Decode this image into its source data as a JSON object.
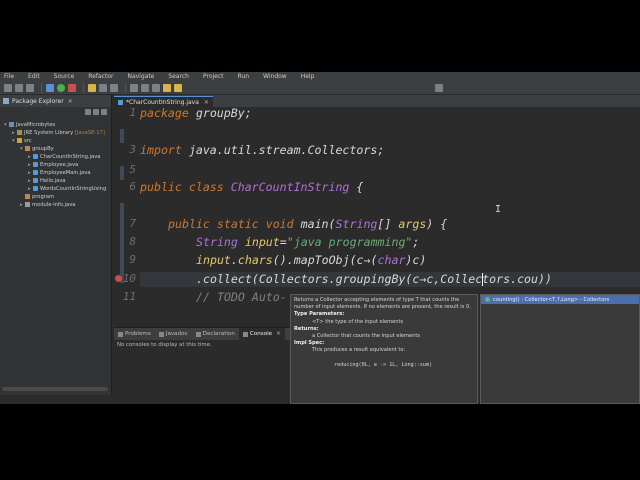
{
  "menu": [
    "File",
    "Edit",
    "Source",
    "Refactor",
    "Navigate",
    "Search",
    "Project",
    "Run",
    "Window",
    "Help"
  ],
  "explorer": {
    "tab_label": "Package Explorer",
    "tree": [
      {
        "label": "JavaMicrobytes",
        "suffix": ""
      },
      {
        "label": "JRE System Library",
        "suffix": "[JavaSE-17]"
      },
      {
        "label": "src",
        "suffix": ""
      },
      {
        "label": "groupBy",
        "suffix": ""
      },
      {
        "label": "CharCountInString.java",
        "suffix": ""
      },
      {
        "label": "Employee.java",
        "suffix": ""
      },
      {
        "label": "EmployeeMain.java",
        "suffix": ""
      },
      {
        "label": "Hello.java",
        "suffix": ""
      },
      {
        "label": "WordsCountInStringUsing",
        "suffix": ""
      },
      {
        "label": "program",
        "suffix": ""
      },
      {
        "label": "module-info.java",
        "suffix": ""
      }
    ]
  },
  "editor": {
    "tab_label": "*CharCountInString.java",
    "line_numbers": [
      "1",
      "3",
      "5",
      "6",
      "7",
      "8",
      "9",
      "10",
      "11"
    ],
    "code": {
      "l1_kw": "package",
      "l1_rest": " groupBy;",
      "l3_kw": "import",
      "l3_rest": " java.util.stream.Collectors;",
      "l5_kw": "public class",
      "l5_name": " CharCountInString",
      "l5_rest": " {",
      "l7_kw": "public static void",
      "l7_rest": " main(",
      "l7_type": "String",
      "l7_arr": "[] ",
      "l7_arg": "args",
      "l7_end": ") {",
      "l8_type": "String",
      "l8_var": " input",
      "l8_eq": "=",
      "l8_str": "\"java programming\"",
      "l8_end": ";",
      "l9_var": "input",
      "l9_dot": ".",
      "l9_var2": "chars",
      "l9_rest": "().mapToObj(c→(",
      "l9_type": "char",
      "l9_end": ")c)",
      "l10": ".collect(Collectors.groupingBy(c→c,Collectors.cou))",
      "l11": "// TODO Auto-"
    }
  },
  "console": {
    "tabs": [
      "Problems",
      "Javadoc",
      "Declaration",
      "Console"
    ],
    "message": "No consoles to display at this time."
  },
  "javadoc": {
    "summary": "Returns a Collector accepting elements of type T that counts the number of input elements. If no elements are present, the result is 0.",
    "type_params_heading": "Type Parameters:",
    "type_param": "<T> the type of the input elements",
    "returns_heading": "Returns:",
    "returns": "a Collector that counts the input elements",
    "impl_heading": "Impl Spec:",
    "impl": "This produces a result equivalent to:",
    "code": "reducing(0L, e -> 1L, Long::sum)"
  },
  "completion": {
    "item": "counting() : Collector<T,?,Long> - Collectors"
  }
}
